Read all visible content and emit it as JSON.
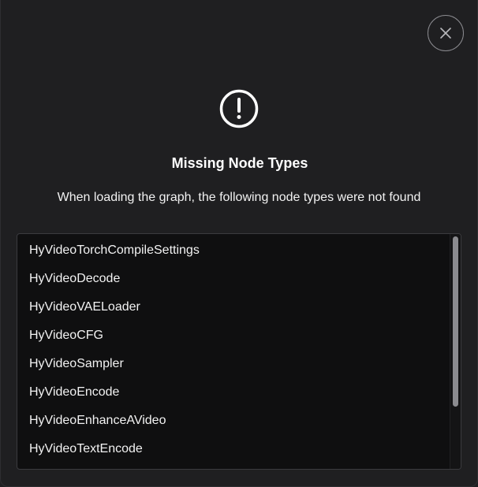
{
  "dialog": {
    "title": "Missing Node Types",
    "message": "When loading the graph, the following node types were not found",
    "close_icon": "close-icon",
    "alert_icon": "exclamation-circle-icon"
  },
  "missing_nodes": [
    "HyVideoTorchCompileSettings",
    "HyVideoDecode",
    "HyVideoVAELoader",
    "HyVideoCFG",
    "HyVideoSampler",
    "HyVideoEncode",
    "HyVideoEnhanceAVideo",
    "HyVideoTextEncode"
  ],
  "colors": {
    "background": "#1f1f21",
    "list_background": "#0f0f10",
    "text": "#ffffff"
  }
}
